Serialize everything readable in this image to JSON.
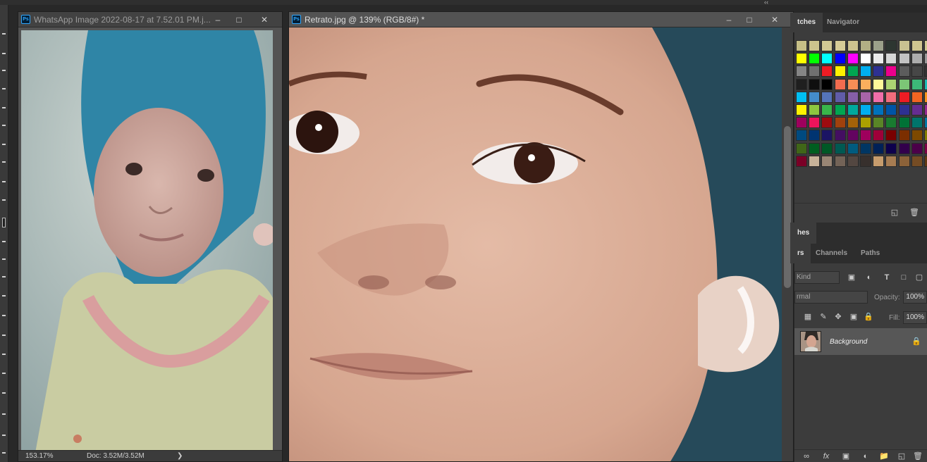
{
  "left_doc": {
    "title": "WhatsApp Image 2022-08-17 at 7.52.01 PM.j...",
    "zoom": "153.17%",
    "doc_info": "Doc: 3.52M/3.52M",
    "status_arrow": "❯"
  },
  "right_doc": {
    "title": "Retrato.jpg @ 139% (RGB/8#) *"
  },
  "panel_top": {
    "tabs": [
      "tches",
      "Navigator"
    ],
    "swatch_colors": [
      [
        "#c6bf86",
        "#ccc48d",
        "#d2c994",
        "#d6cc97",
        "#cdc38f",
        "#b2af84",
        "#9ba08a",
        "#2d3631",
        "#c8c191",
        "#d0c690",
        "#d1c891"
      ],
      [
        "#ffff00",
        "#00ff00",
        "#00ffff",
        "#0000ff",
        "#ff00ff",
        "#ffffff",
        "#ebebeb",
        "#d6d6d6",
        "#c2c2c2",
        "#adadad",
        "#999999"
      ],
      [
        "#858585",
        "#707070",
        "#ed1c24",
        "#fff200",
        "#00a651",
        "#00aeef",
        "#2e3192",
        "#ec008c",
        "#5c5c5c",
        "#474747",
        "#333333"
      ],
      [
        "#1f1f1f",
        "#0f0f0f",
        "#000000",
        "#f26c4f",
        "#f68e56",
        "#fbaf5d",
        "#fff799",
        "#acd372",
        "#7cc576",
        "#3cb878",
        "#1cbbb4"
      ],
      [
        "#00bff3",
        "#448ccb",
        "#5574b9",
        "#605ca8",
        "#855fa8",
        "#a864a8",
        "#f06ea9",
        "#f26d7d",
        "#ed1c24",
        "#f26522",
        "#f7941d"
      ],
      [
        "#fff200",
        "#8dc63f",
        "#39b54a",
        "#00a651",
        "#00a99d",
        "#00aeef",
        "#0072bc",
        "#0054a6",
        "#2e3192",
        "#662d91",
        "#92278f"
      ],
      [
        "#9e005d",
        "#ed145b",
        "#9e0b0f",
        "#a0410d",
        "#a36209",
        "#aba000",
        "#598527",
        "#197b30",
        "#007236",
        "#00746b",
        "#0076a3"
      ],
      [
        "#004a80",
        "#003471",
        "#1b1464",
        "#440e62",
        "#630460",
        "#9e005d",
        "#9e0039",
        "#790000",
        "#7b2e00",
        "#7d4900",
        "#827b00"
      ],
      [
        "#406618",
        "#005e20",
        "#005826",
        "#005952",
        "#005b7f",
        "#003663",
        "#002157",
        "#0d004c",
        "#32004b",
        "#4b0049",
        "#7b0046"
      ],
      [
        "#7a0026",
        "#c7b299",
        "#998675",
        "#736357",
        "#534741",
        "#37302d",
        "#c69c6d",
        "#a67c52",
        "#8c6239",
        "#754c24",
        "#603913"
      ]
    ]
  },
  "panel_mid": {
    "tab_label": "hes"
  },
  "layers_panel": {
    "tabs": [
      "rs",
      "Channels",
      "Paths"
    ],
    "kind_label": "Kind",
    "blend_mode": "rmal",
    "opacity_label": "Opacity:",
    "opacity_value": "100%",
    "fill_label": "Fill:",
    "fill_value": "100%",
    "layers": [
      {
        "name": "Background",
        "locked": true
      }
    ]
  },
  "top_strip": {
    "collapse_glyph": "‹‹"
  }
}
